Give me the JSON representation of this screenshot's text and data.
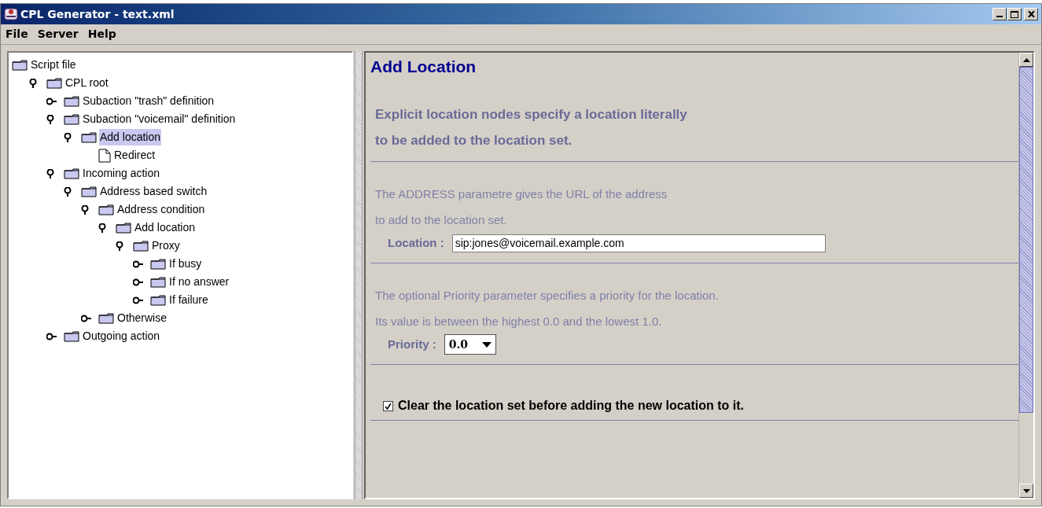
{
  "window": {
    "title": "CPL Generator - text.xml"
  },
  "menu": [
    "File",
    "Server",
    "Help"
  ],
  "tree": [
    {
      "label": "Script file",
      "kind": "root",
      "selected": false,
      "children": [
        {
          "label": "CPL root",
          "kind": "folder",
          "expanded": true,
          "selected": false,
          "children": [
            {
              "label": "Subaction \"trash\" definition",
              "kind": "folder",
              "expanded": false,
              "selected": false
            },
            {
              "label": "Subaction \"voicemail\" definition",
              "kind": "folder",
              "expanded": true,
              "selected": false,
              "children": [
                {
                  "label": "Add location",
                  "kind": "folder",
                  "expanded": true,
                  "selected": true,
                  "children": [
                    {
                      "label": "Redirect",
                      "kind": "file",
                      "selected": false
                    }
                  ]
                }
              ]
            },
            {
              "label": "Incoming action",
              "kind": "folder",
              "expanded": true,
              "selected": false,
              "children": [
                {
                  "label": "Address based switch",
                  "kind": "folder",
                  "expanded": true,
                  "selected": false,
                  "children": [
                    {
                      "label": "Address condition",
                      "kind": "folder",
                      "expanded": true,
                      "selected": false,
                      "children": [
                        {
                          "label": "Add location",
                          "kind": "folder",
                          "expanded": true,
                          "selected": false,
                          "children": [
                            {
                              "label": "Proxy",
                              "kind": "folder",
                              "expanded": true,
                              "selected": false,
                              "children": [
                                {
                                  "label": "If busy",
                                  "kind": "folder",
                                  "expanded": false,
                                  "selected": false
                                },
                                {
                                  "label": "If no answer",
                                  "kind": "folder",
                                  "expanded": false,
                                  "selected": false
                                },
                                {
                                  "label": "If failure",
                                  "kind": "folder",
                                  "expanded": false,
                                  "selected": false
                                }
                              ]
                            }
                          ]
                        }
                      ]
                    },
                    {
                      "label": "Otherwise",
                      "kind": "folder",
                      "expanded": false,
                      "selected": false
                    }
                  ]
                }
              ]
            },
            {
              "label": "Outgoing action",
              "kind": "folder",
              "expanded": false,
              "selected": false
            }
          ]
        }
      ]
    }
  ],
  "details": {
    "title": "Add Location",
    "sections": [
      {
        "kind": "intro",
        "lines": [
          "Explicit location nodes specify a location literally",
          "to be added to the location set."
        ]
      },
      {
        "kind": "field",
        "lines": [
          "The ADDRESS parametre gives the URL of the address",
          "to add to the location set."
        ],
        "label": "Location :",
        "value": "sip:jones@voicemail.example.com"
      },
      {
        "kind": "select",
        "lines": [
          "The optional Priority parameter specifies a priority for the location.",
          "Its value is between the highest 0.0 and the lowest 1.0."
        ],
        "label": "Priority :",
        "value": "0.0"
      },
      {
        "kind": "checkbox",
        "label": "Clear the location set before adding the new location to it.",
        "checked": true
      }
    ]
  }
}
